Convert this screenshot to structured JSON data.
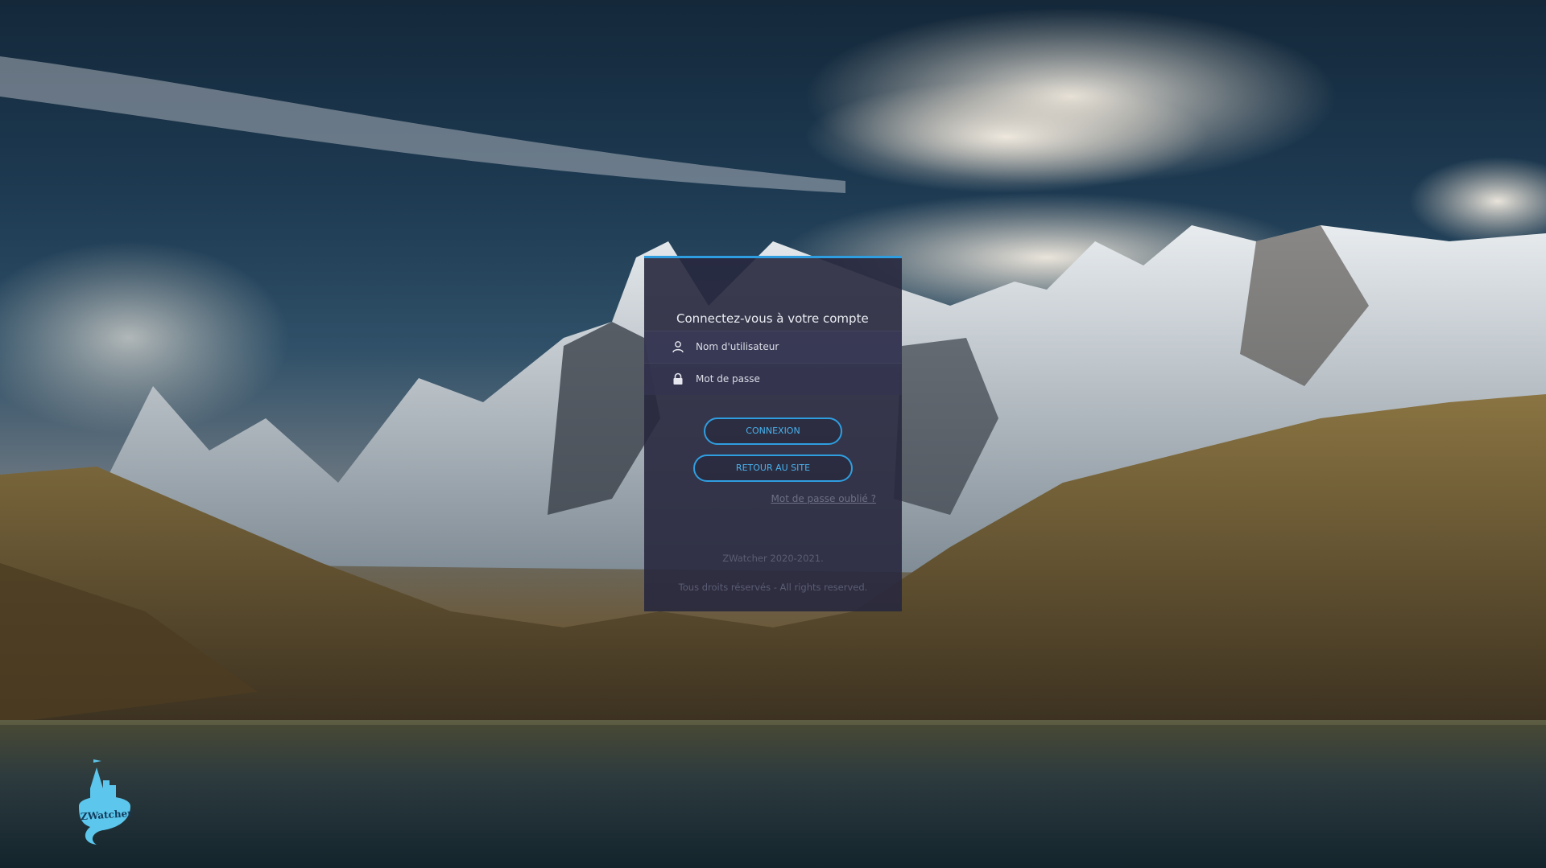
{
  "login": {
    "title": "Connectez-vous à votre compte",
    "username_placeholder": "Nom d'utilisateur",
    "password_placeholder": "Mot de passe",
    "connexion_label": "CONNEXION",
    "retour_label": "RETOUR AU SITE",
    "forgot_label": "Mot de passe oublié ?",
    "footer_line1": "ZWatcher 2020-2021.",
    "footer_line2": "Tous droits réservés - All rights reserved."
  },
  "brand": {
    "name": "ZWatcher"
  },
  "colors": {
    "accent": "#2f9ee0",
    "panel": "#28283e",
    "logo": "#5cc6ec"
  },
  "icons": {
    "username": "user-icon",
    "password": "lock-icon",
    "logo": "castle-logo-icon"
  }
}
